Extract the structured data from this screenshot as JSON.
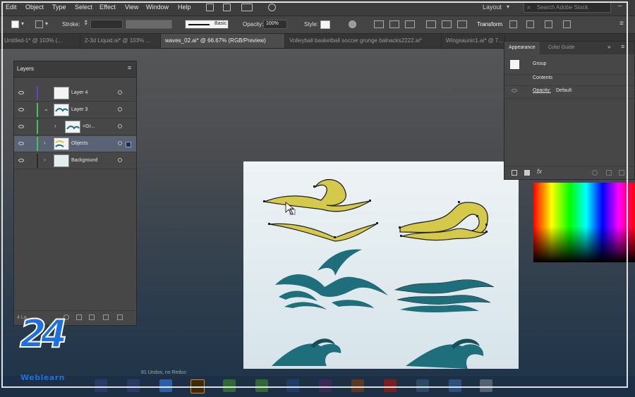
{
  "menu": {
    "items": [
      "Edit",
      "Object",
      "Type",
      "Select",
      "Effect",
      "View",
      "Window",
      "Help"
    ]
  },
  "workspace": {
    "label": "Layout"
  },
  "search": {
    "placeholder": "Search Adobe Stock"
  },
  "control_bar": {
    "stroke_label": "Stroke:",
    "brush_label": "Basic",
    "opacity_label": "Opacity:",
    "opacity_value": "100%",
    "style_label": "Style:",
    "transform_label": "Transform"
  },
  "tabs": [
    {
      "label": "Untitled-1* @ 103% (...",
      "active": false
    },
    {
      "label": "2-3d Liquid.ai* @ 103% ...",
      "active": false
    },
    {
      "label": "waves_02.ai* @ 66.67% (RGB/Preview)",
      "active": true
    },
    {
      "label": "Volleyball basketball soccer grunge balnacks2222.ai*",
      "active": false
    },
    {
      "label": "Wingsaunic1.ai* @ 7...",
      "active": false
    }
  ],
  "layers_panel": {
    "title": "Layers",
    "rows": [
      {
        "name": "Layer 4",
        "color": "#6a3fd0",
        "expand": false,
        "selected": false
      },
      {
        "name": "Layer 3",
        "color": "#3fc65a",
        "expand": true,
        "selected": false
      },
      {
        "name": "<Gr...",
        "color": "#3fc65a",
        "expand": false,
        "selected": false
      },
      {
        "name": "Objects",
        "color": "#3fc65a",
        "expand": false,
        "selected": true
      },
      {
        "name": "Background",
        "color": "#2a2a2a",
        "expand": false,
        "selected": false
      }
    ],
    "footer_count": "4 La..."
  },
  "appearance_panel": {
    "tabs": [
      "Appearance",
      "Color Guide"
    ],
    "group_label": "Group",
    "contents_label": "Contents",
    "opacity_label": "Opacity:",
    "opacity_value": "Default"
  },
  "status_bar": {
    "text": "81 Undos, no Redos"
  },
  "watermark": {
    "number": "24",
    "brand": "Weblearn"
  },
  "colors": {
    "wave_yellow": "#d4c94a",
    "wave_teal": "#1f6e7b",
    "selection_blue": "#5a6374"
  },
  "icons": [
    "eye-icon",
    "search-icon",
    "chevron-down-icon",
    "new-layer-icon",
    "delete-icon",
    "transform-icon"
  ]
}
